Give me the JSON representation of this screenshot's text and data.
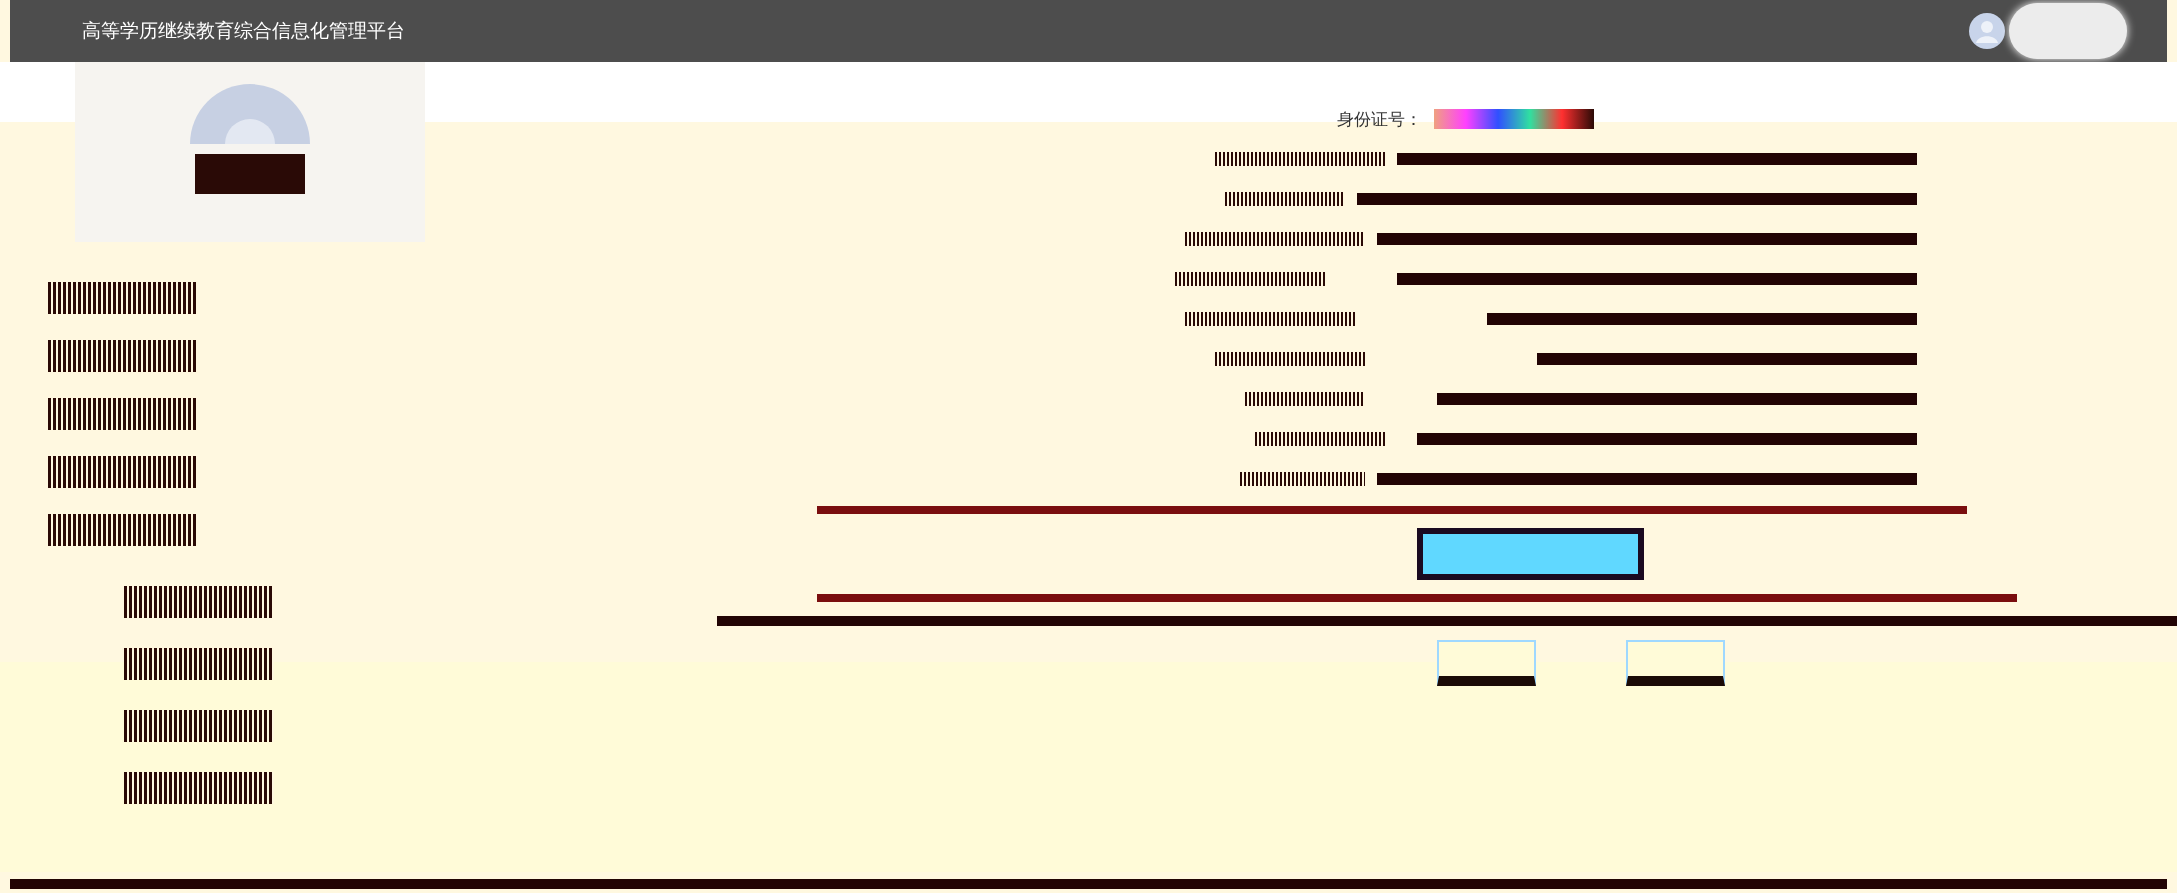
{
  "header": {
    "title": "高等学历继续教育综合信息化管理平台"
  },
  "form": {
    "id_label": "身份证号："
  }
}
